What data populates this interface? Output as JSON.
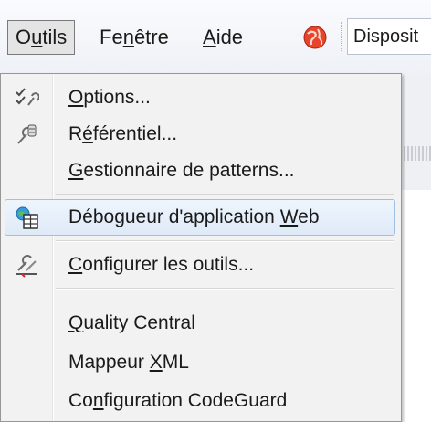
{
  "menubar": {
    "items": [
      {
        "pre": "O",
        "mn": "u",
        "post": "tils"
      },
      {
        "pre": "Fe",
        "mn": "n",
        "post": "être"
      },
      {
        "pre": "",
        "mn": "A",
        "post": "ide"
      }
    ],
    "combo_value": "Disposit"
  },
  "menu": {
    "items": [
      {
        "pre": "",
        "mn": "O",
        "post": "ptions..."
      },
      {
        "pre": "R",
        "mn": "é",
        "post": "férentiel..."
      },
      {
        "pre": "",
        "mn": "G",
        "post": "estionnaire de patterns..."
      },
      {
        "pre": "Débogueur d'application ",
        "mn": "W",
        "post": "eb"
      },
      {
        "pre": "",
        "mn": "C",
        "post": "onfigurer les outils..."
      },
      {
        "pre": "",
        "mn": "Q",
        "post": "uality Central"
      },
      {
        "pre": "Mappeur ",
        "mn": "X",
        "post": "ML"
      },
      {
        "pre": "Co",
        "mn": "n",
        "post": "figuration CodeGuard"
      }
    ]
  },
  "colors": {
    "hover_border": "#9fbfe3",
    "menu_bg": "#f2f2f2"
  }
}
